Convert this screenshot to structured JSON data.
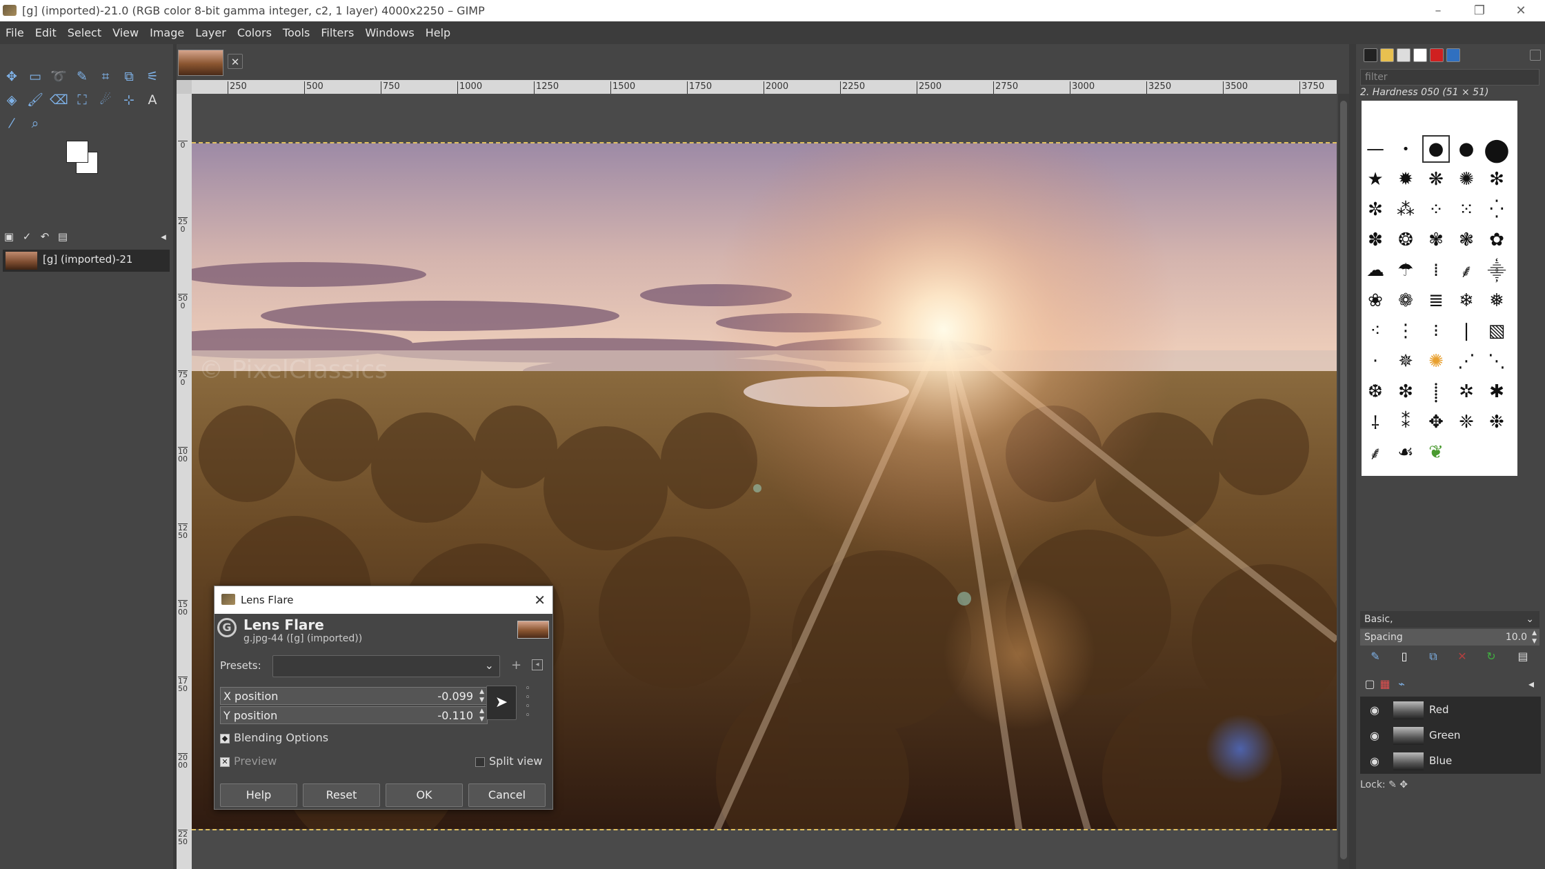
{
  "window": {
    "title": "[g] (imported)-21.0 (RGB color 8-bit gamma integer, c2, 1 layer) 4000x2250 – GIMP",
    "controls": [
      "–",
      "❐",
      "✕"
    ]
  },
  "menu": [
    "File",
    "Edit",
    "Select",
    "View",
    "Image",
    "Layer",
    "Colors",
    "Tools",
    "Filters",
    "Windows",
    "Help"
  ],
  "images_panel": {
    "image_label": "[g] (imported)-21"
  },
  "ruler": {
    "h_ticks": [
      "250",
      "500",
      "750",
      "1000",
      "1250",
      "1500",
      "1750",
      "2000",
      "2250",
      "2500",
      "2750",
      "3000",
      "3250",
      "3500",
      "3750"
    ],
    "v_ticks": [
      "0",
      "250",
      "500",
      "750",
      "1000",
      "1250",
      "1500",
      "1750",
      "2000",
      "2250"
    ]
  },
  "canvas": {
    "watermark": "© PixelClassics"
  },
  "brushes": {
    "filter_placeholder": "filter",
    "selected_brush": "2. Hardness 050 (51 × 51)",
    "preset": "Basic,",
    "spacing_label": "Spacing",
    "spacing_value": "10.0"
  },
  "channels": [
    {
      "name": "Red"
    },
    {
      "name": "Green"
    },
    {
      "name": "Blue"
    }
  ],
  "lock_label": "Lock:",
  "dialog": {
    "title": "Lens Flare",
    "heading": "Lens Flare",
    "subtitle": "g.jpg-44 ([g] (imported))",
    "presets_label": "Presets:",
    "presets_value": "",
    "x_label": "X position",
    "x_value": "-0.099",
    "y_label": "Y position",
    "y_value": "-0.110",
    "blending_label": "Blending Options",
    "preview_label": "Preview",
    "split_view_label": "Split view",
    "buttons": {
      "help": "Help",
      "reset": "Reset",
      "ok": "OK",
      "cancel": "Cancel"
    }
  },
  "colors": {
    "accent": "#7fb2e8",
    "panel_bg": "#454545",
    "dark_bg": "#2b2b2b"
  }
}
